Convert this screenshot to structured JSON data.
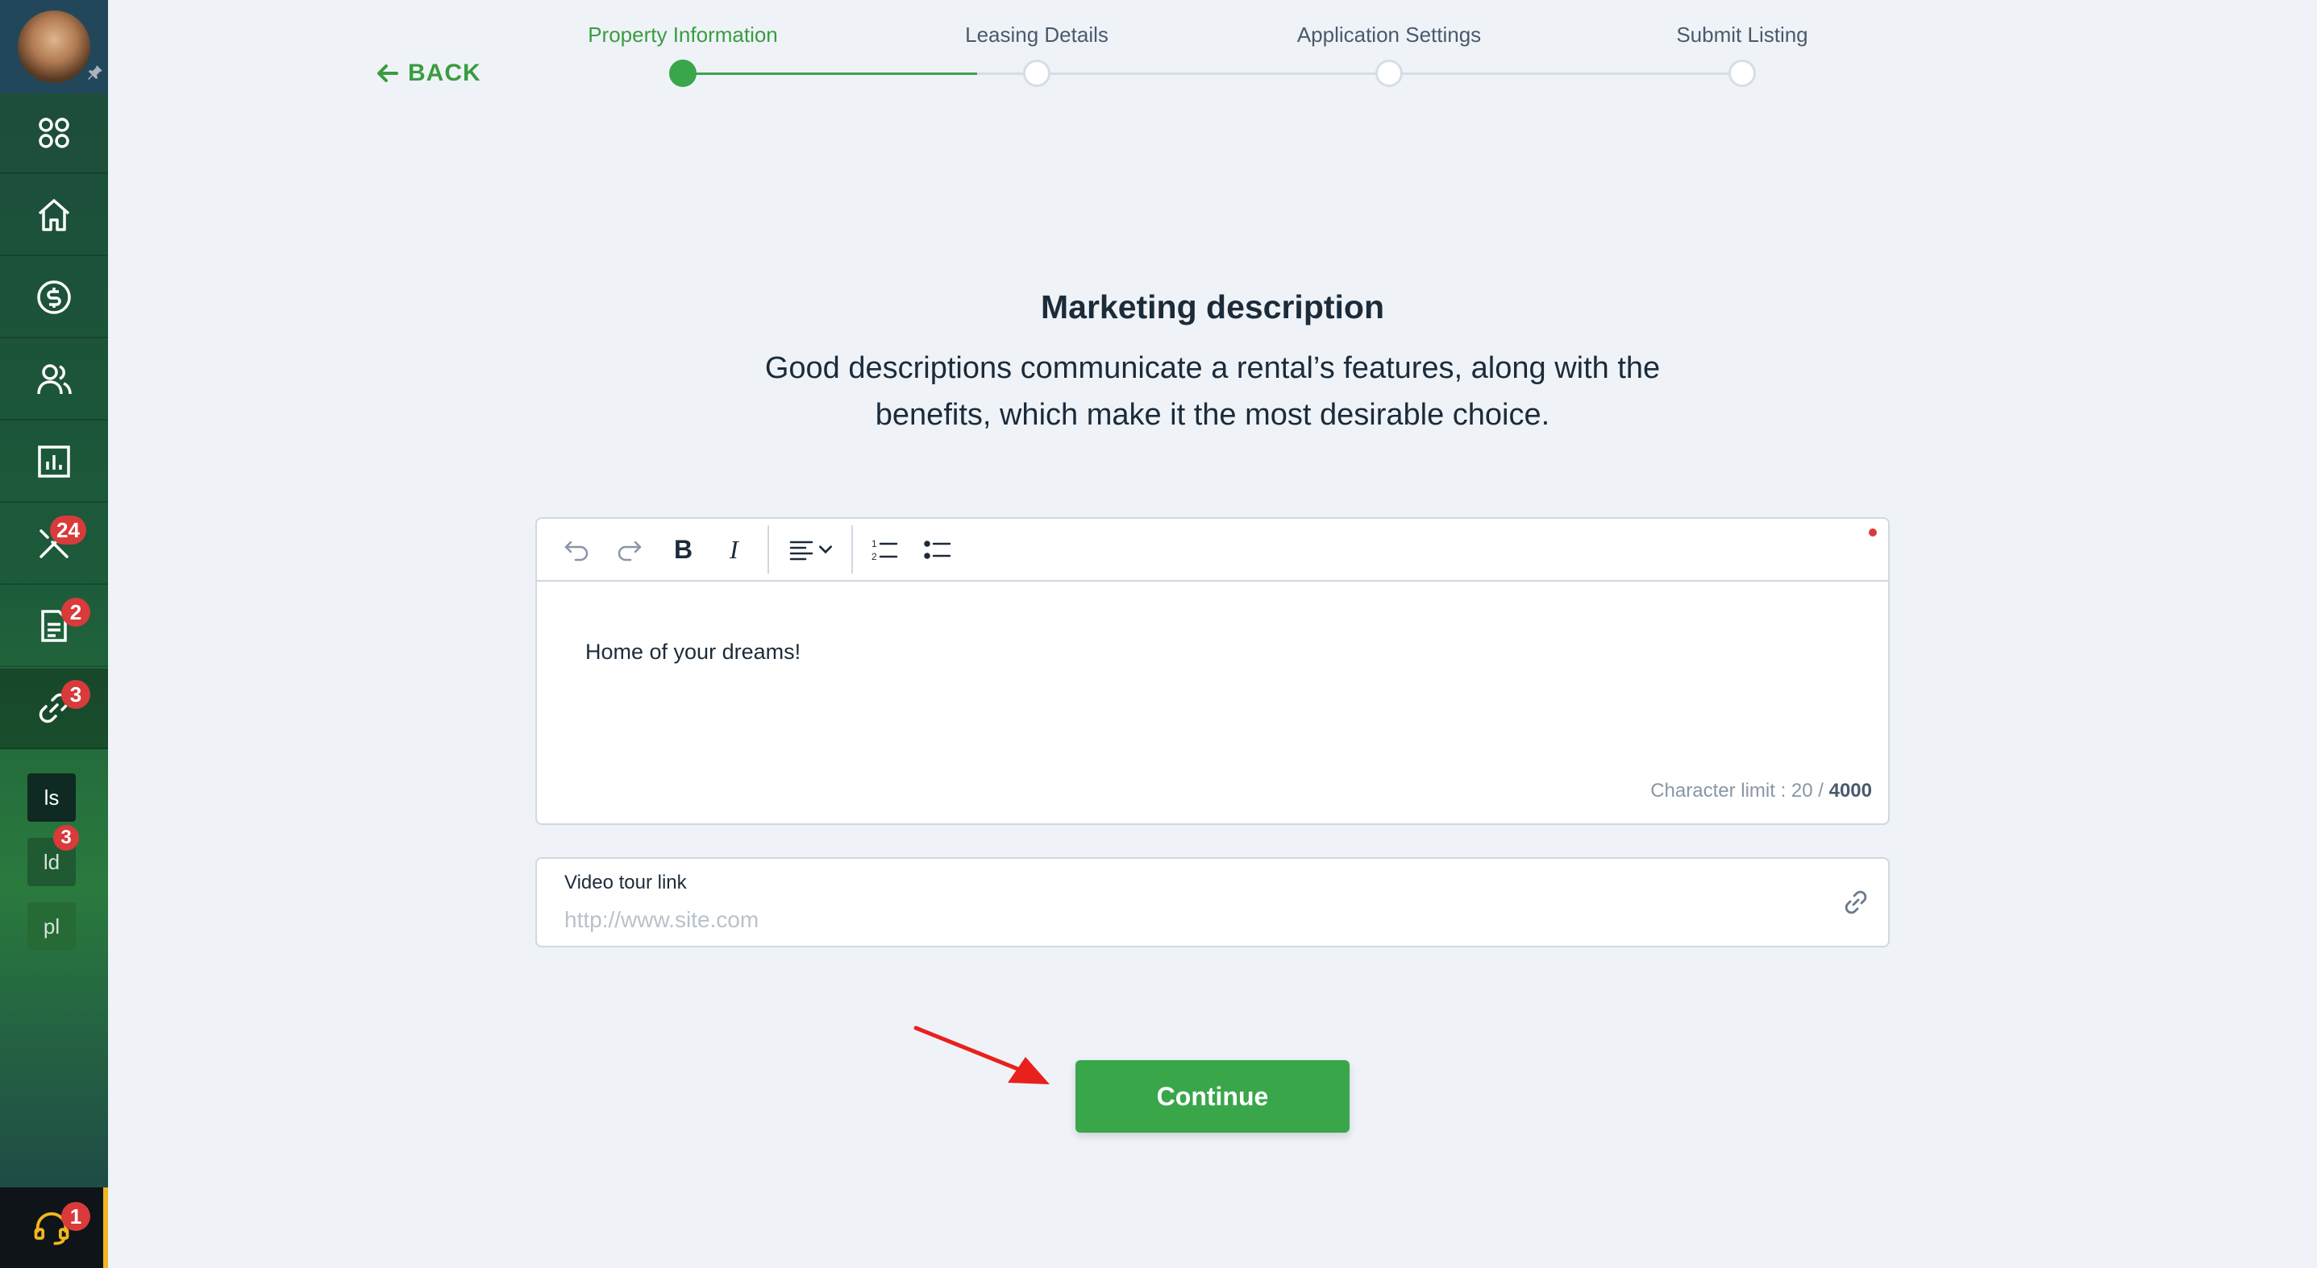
{
  "sidebar": {
    "badges": {
      "tools": "24",
      "documents": "2",
      "links": "3",
      "ld": "3",
      "help": "1"
    },
    "mini_tabs": [
      "ls",
      "ld",
      "pl"
    ]
  },
  "stepper": {
    "back_label": "BACK",
    "steps": [
      "Property Information",
      "Leasing Details",
      "Application Settings",
      "Submit Listing"
    ]
  },
  "main": {
    "heading": "Marketing description",
    "subtitle": "Good descriptions communicate a rental’s features, along with the benefits, which make it the most desirable choice."
  },
  "editor": {
    "content": "Home of your dreams!",
    "char_limit_prefix": "Character limit : 20 / ",
    "char_limit_max": "4000"
  },
  "video": {
    "label": "Video tour link",
    "placeholder": "http://www.site.com"
  },
  "continue_label": "Continue",
  "colors": {
    "accent": "#3aa64a",
    "badge": "#d93a3a",
    "highlight": "#f2b61e"
  }
}
